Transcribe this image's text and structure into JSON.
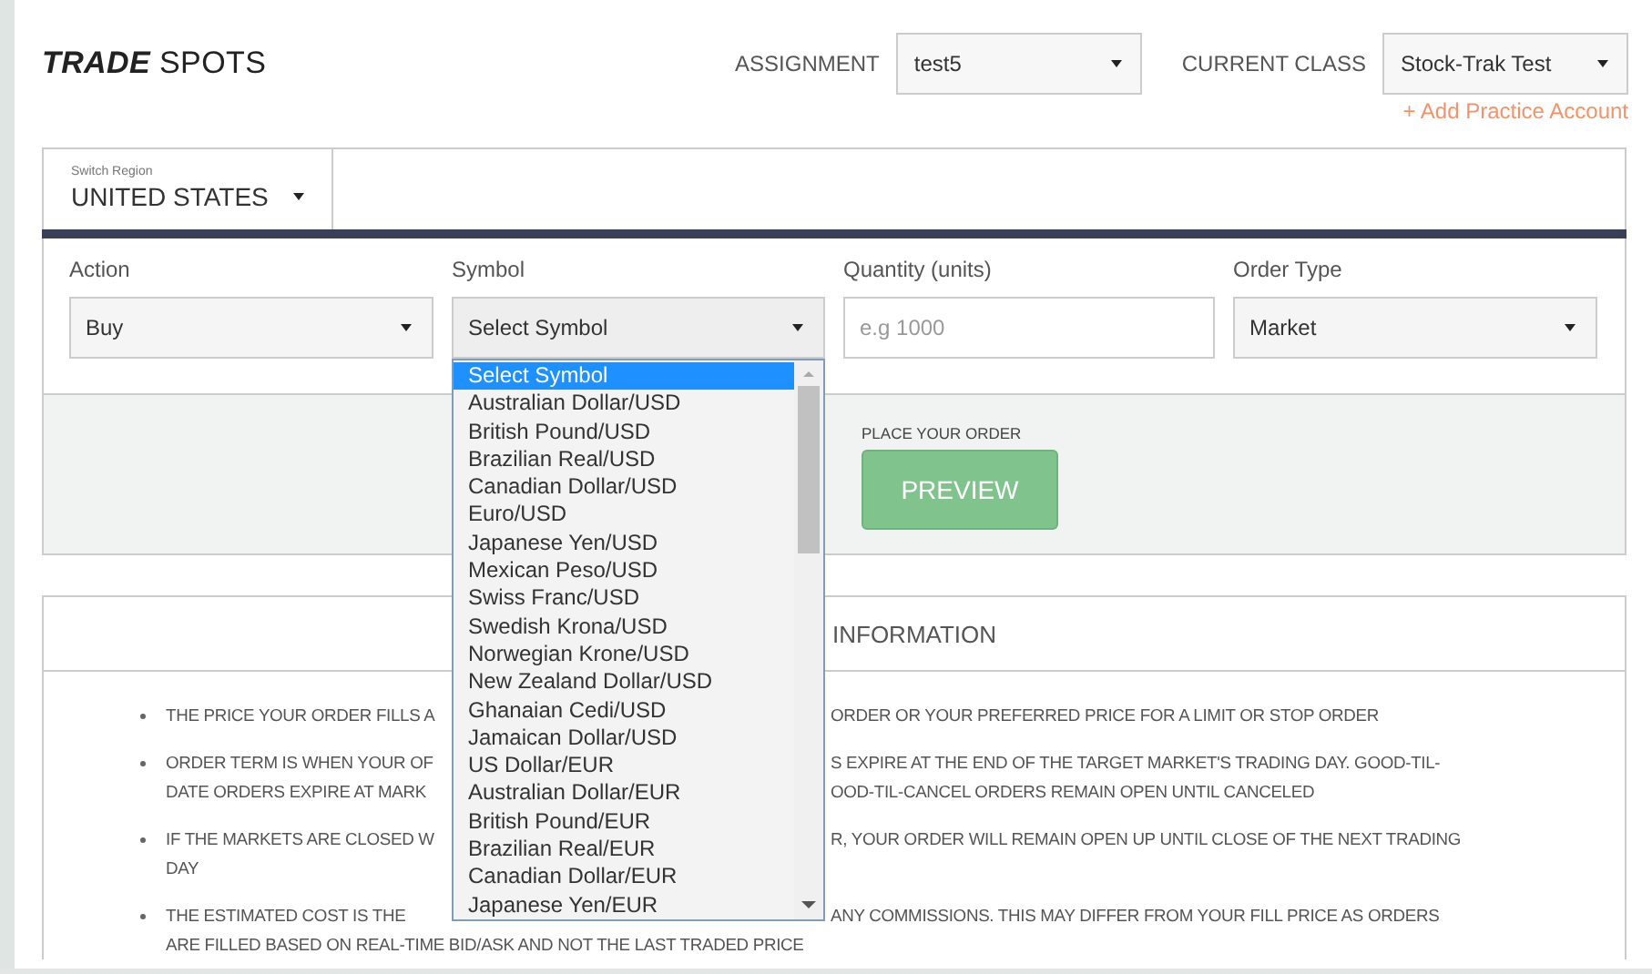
{
  "page_title": "**TRADE** SPOTS",
  "assignment": {
    "label": "ASSIGNMENT",
    "value": "test5"
  },
  "current_class": {
    "label": "CURRENT CLASS",
    "value": "Stock-Trak Test"
  },
  "add_account_link": "+ Add Practice Account",
  "region": {
    "caption": "Switch Region",
    "value": "UNITED STATES"
  },
  "order_fields": [
    {
      "kind": "select",
      "label": "Action",
      "value": "Buy",
      "expanded": false
    },
    {
      "kind": "select",
      "label": "Symbol",
      "value": "Select Symbol",
      "expanded": true
    },
    {
      "kind": "input",
      "label": "Quantity (units)",
      "placeholder": "e.g 1000"
    },
    {
      "kind": "select",
      "label": "Order Type",
      "value": "Market",
      "expanded": false
    }
  ],
  "symbol_options": [
    {
      "label": "Select Symbol",
      "selected": true
    },
    {
      "label": "Australian Dollar/USD",
      "selected": false
    },
    {
      "label": "British Pound/USD",
      "selected": false
    },
    {
      "label": "Brazilian Real/USD",
      "selected": false
    },
    {
      "label": "Canadian Dollar/USD",
      "selected": false
    },
    {
      "label": "Euro/USD",
      "selected": false
    },
    {
      "label": "Japanese Yen/USD",
      "selected": false
    },
    {
      "label": "Mexican Peso/USD",
      "selected": false
    },
    {
      "label": "Swiss Franc/USD",
      "selected": false
    },
    {
      "label": "Swedish Krona/USD",
      "selected": false
    },
    {
      "label": "Norwegian Krone/USD",
      "selected": false
    },
    {
      "label": "New Zealand Dollar/USD",
      "selected": false
    },
    {
      "label": "Ghanaian Cedi/USD",
      "selected": false
    },
    {
      "label": "Jamaican Dollar/USD",
      "selected": false
    },
    {
      "label": "US Dollar/EUR",
      "selected": false
    },
    {
      "label": "Australian Dollar/EUR",
      "selected": false
    },
    {
      "label": "British Pound/EUR",
      "selected": false
    },
    {
      "label": "Brazilian Real/EUR",
      "selected": false
    },
    {
      "label": "Canadian Dollar/EUR",
      "selected": false
    },
    {
      "label": "Japanese Yen/EUR",
      "selected": false
    }
  ],
  "place_order": {
    "caption": "PLACE YOUR ORDER",
    "button": "PREVIEW"
  },
  "information": {
    "title": "INFORMATION",
    "bullets": [
      {
        "lines": [
          {
            "left": "THE PRICE YOUR ORDER FILLS A",
            "right": "ORDER OR YOUR PREFERRED PRICE FOR A LIMIT OR STOP ORDER"
          }
        ]
      },
      {
        "lines": [
          {
            "left": "ORDER TERM IS WHEN YOUR OF",
            "right": "S EXPIRE AT THE END OF THE TARGET MARKET'S TRADING DAY. GOOD-TIL-"
          },
          {
            "left": "DATE ORDERS EXPIRE AT MARK",
            "right": "OOD-TIL-CANCEL ORDERS REMAIN OPEN UNTIL CANCELED"
          }
        ]
      },
      {
        "lines": [
          {
            "left": "IF THE MARKETS ARE CLOSED W",
            "right": "R, YOUR ORDER WILL REMAIN OPEN UP UNTIL CLOSE OF THE NEXT TRADING"
          },
          {
            "left": "DAY"
          }
        ]
      },
      {
        "lines": [
          {
            "left": "THE ESTIMATED COST IS THE",
            "right": "ANY COMMISSIONS. THIS MAY DIFFER FROM YOUR FILL PRICE AS ORDERS"
          },
          {
            "left": "ARE FILLED BASED ON REAL-TIME BID/ASK AND NOT THE LAST TRADED PRICE"
          }
        ]
      }
    ]
  }
}
